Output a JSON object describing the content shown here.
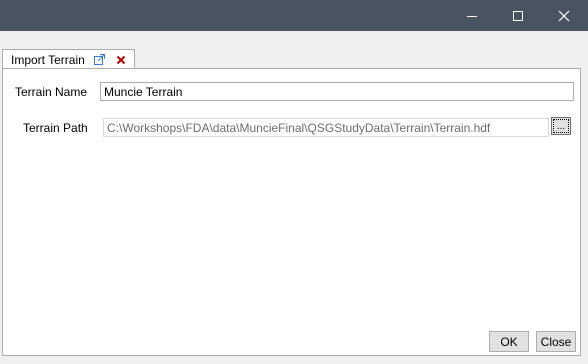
{
  "window": {
    "controls": [
      "minimize-icon",
      "maximize-icon",
      "close-icon"
    ]
  },
  "tab": {
    "label": "Import Terrain",
    "popout_icon": "popout-icon",
    "close_icon": "close-tab-icon",
    "close_color": "#c00000"
  },
  "form": {
    "name_label": "Terrain Name",
    "name_value": "Muncie Terrain",
    "path_label": "Terrain Path",
    "path_value": "C:\\Workshops\\FDA\\data\\MuncieFinal\\QSGStudyData\\Terrain\\Terrain.hdf",
    "browse_label": "..."
  },
  "buttons": {
    "ok": "OK",
    "close": "Close"
  },
  "colors": {
    "titlebar": "#4a5361"
  }
}
